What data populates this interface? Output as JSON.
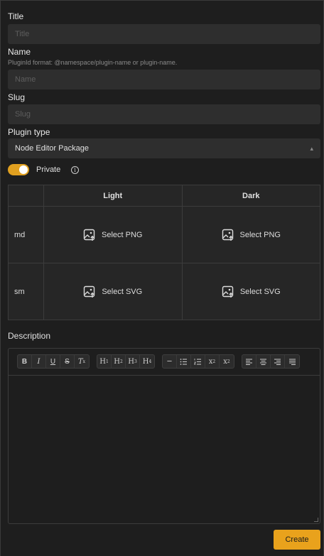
{
  "form": {
    "title": {
      "label": "Title",
      "placeholder": "Title",
      "value": ""
    },
    "name": {
      "label": "Name",
      "hint": "PluginId format: @namespace/plugin-name or plugin-name.",
      "placeholder": "Name",
      "value": ""
    },
    "slug": {
      "label": "Slug",
      "placeholder": "Slug",
      "value": ""
    },
    "plugin_type": {
      "label": "Plugin type",
      "selected": "Node Editor Package",
      "arrow": "⌃⌄"
    },
    "private": {
      "label": "Private",
      "on": true,
      "info": "i"
    }
  },
  "icons_table": {
    "headers": [
      "",
      "Light",
      "Dark"
    ],
    "rows": [
      {
        "size": "md",
        "light": "Select PNG",
        "dark": "Select PNG"
      },
      {
        "size": "sm",
        "light": "Select SVG",
        "dark": "Select SVG"
      }
    ]
  },
  "description": {
    "label": "Description",
    "toolbar": {
      "format": [
        "B",
        "I",
        "U",
        "S",
        "Tx"
      ],
      "headings": [
        "H1",
        "H2",
        "H3",
        "H4"
      ],
      "lists": [
        "hr",
        "ul",
        "ol",
        "x2",
        "x²"
      ],
      "align": [
        "left",
        "center",
        "right",
        "justify"
      ]
    }
  },
  "actions": {
    "create_label": "Create"
  },
  "colors": {
    "accent": "#e9a21c",
    "background": "#1e1e1e",
    "input": "#2e2e2e"
  }
}
